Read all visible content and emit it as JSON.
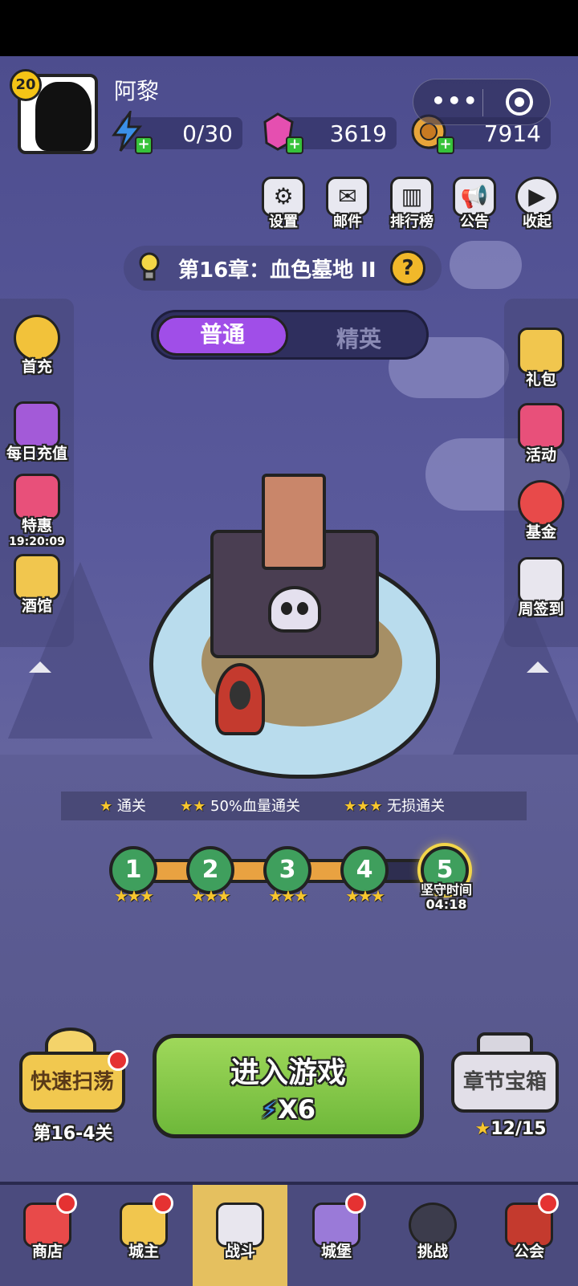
{
  "player": {
    "level": "20",
    "name": "阿黎",
    "energy": "0/30",
    "gems": "3619",
    "coins": "7914"
  },
  "top_icons": [
    {
      "label": "设置",
      "icon": "gear-icon"
    },
    {
      "label": "邮件",
      "icon": "mail-icon"
    },
    {
      "label": "排行榜",
      "icon": "leaderboard-icon"
    },
    {
      "label": "公告",
      "icon": "megaphone-icon"
    },
    {
      "label": "收起",
      "icon": "play-icon"
    }
  ],
  "chapter": {
    "title": "第16章：血色墓地 II"
  },
  "mode_tabs": {
    "normal": "普通",
    "elite": "精英"
  },
  "left_panel": [
    {
      "label": "首充",
      "icon": "star-one-icon",
      "color": "#f2c23a"
    },
    {
      "label": "每日充值",
      "icon": "treasure-chest-icon",
      "color": "#a35ad8"
    },
    {
      "label": "特惠",
      "timer": "19:20:09",
      "icon": "gift-chest-icon",
      "color": "#e8507a"
    },
    {
      "label": "酒馆",
      "icon": "beer-mug-icon",
      "color": "#f1c64e"
    }
  ],
  "right_panel": [
    {
      "label": "礼包",
      "icon": "gift-box-icon",
      "color": "#f1c64e"
    },
    {
      "label": "活动",
      "icon": "stars-box-icon",
      "color": "#e8507a"
    },
    {
      "label": "基金",
      "icon": "money-bag-icon",
      "color": "#e84a4a"
    },
    {
      "label": "周签到",
      "icon": "calendar-check-icon",
      "color": "#e8e6ee"
    }
  ],
  "goals": [
    {
      "stars": "★",
      "label": "通关"
    },
    {
      "stars": "★★",
      "label": "50%血量通关"
    },
    {
      "stars": "★★★",
      "label": "无损通关"
    }
  ],
  "stages": [
    {
      "num": "1",
      "stars": "★★★"
    },
    {
      "num": "2",
      "stars": "★★★"
    },
    {
      "num": "3",
      "stars": "★★★"
    },
    {
      "num": "4",
      "stars": "★★★"
    },
    {
      "num": "5",
      "label": "坚守时间",
      "time": "04:18"
    }
  ],
  "actions": {
    "sweep_label": "快速扫荡",
    "sweep_sub": "第16-4关",
    "enter_label": "进入游戏",
    "enter_cost": "X6",
    "chest_label": "章节宝箱",
    "chest_progress": "12/15"
  },
  "nav": [
    {
      "label": "商店",
      "icon": "shop-icon"
    },
    {
      "label": "城主",
      "icon": "crown-icon"
    },
    {
      "label": "战斗",
      "icon": "crossed-swords-icon"
    },
    {
      "label": "城堡",
      "icon": "castle-icon"
    },
    {
      "label": "挑战",
      "icon": "demon-icon"
    },
    {
      "label": "公会",
      "icon": "guild-book-icon"
    }
  ],
  "colors": {
    "accent_purple": "#a04ee8",
    "enter_green": "#7cc545",
    "nav_active": "#e5c05f"
  }
}
